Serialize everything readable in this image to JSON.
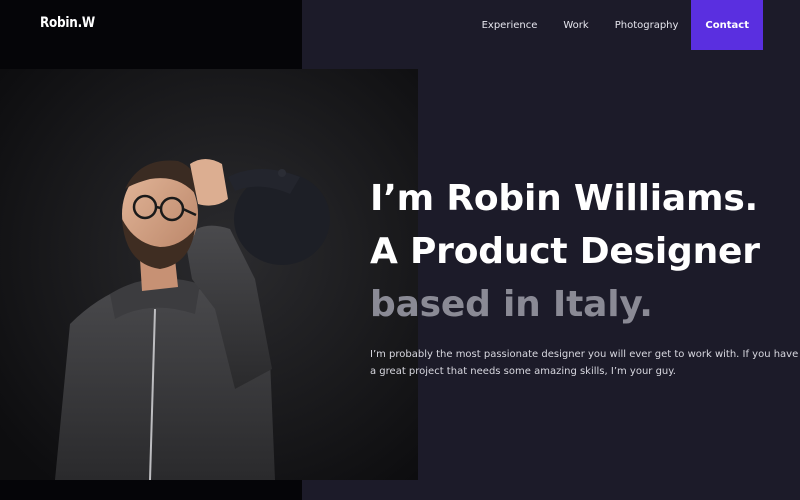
{
  "header": {
    "logo": "Robin.W",
    "nav": [
      {
        "label": "Experience"
      },
      {
        "label": "Work"
      },
      {
        "label": "Photography"
      },
      {
        "label": "Contact",
        "highlighted": true
      }
    ]
  },
  "hero": {
    "headline_line1": "I’m Robin Williams.",
    "headline_line2": "A Product Designer",
    "headline_line3": "based in Italy.",
    "intro": "I’m probably the most passionate designer you will ever get to work with. If you have a great project that needs some amazing skills, I’m your guy."
  },
  "colors": {
    "background": "#1c1b29",
    "accent": "#5a2fe0",
    "muted_text": "#8a8a95",
    "text": "#ffffff"
  }
}
